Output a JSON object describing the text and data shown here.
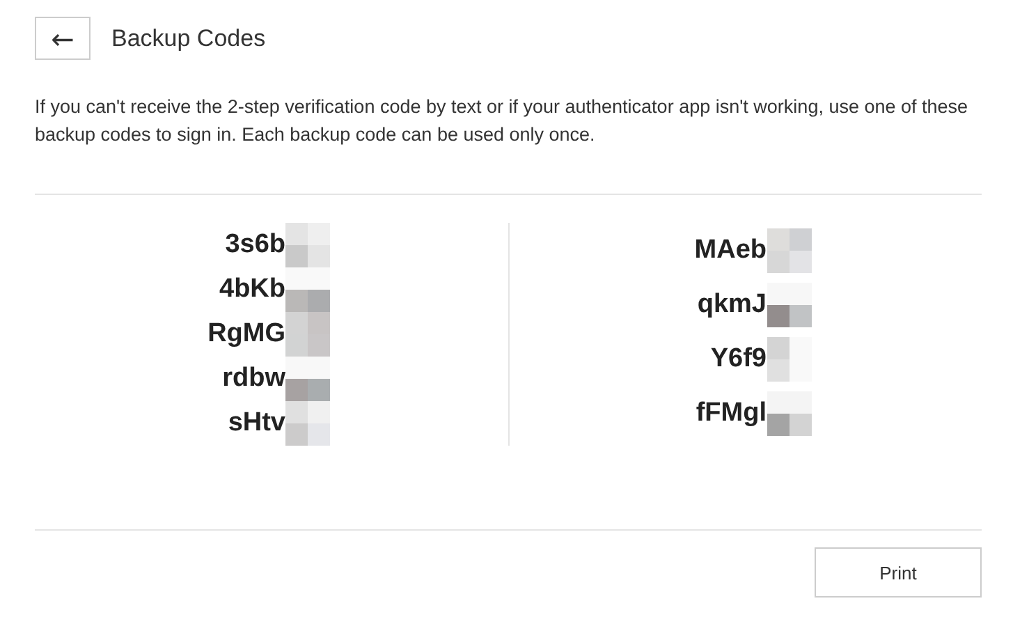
{
  "header": {
    "back": "←",
    "title": "Backup Codes"
  },
  "description": "If you can't receive the 2-step verification code by text or if your authenticator app isn't working, use one of these backup codes to sign in. Each backup code can be used only once.",
  "code_columns": [
    [
      "3s6b",
      "4bKb",
      "RgMG",
      "rdbw",
      "sHtv"
    ],
    [
      "MAeb",
      "qkmJ",
      "Y6f9",
      "fFMgl"
    ]
  ],
  "buttons": [
    {
      "label": "Print"
    }
  ]
}
